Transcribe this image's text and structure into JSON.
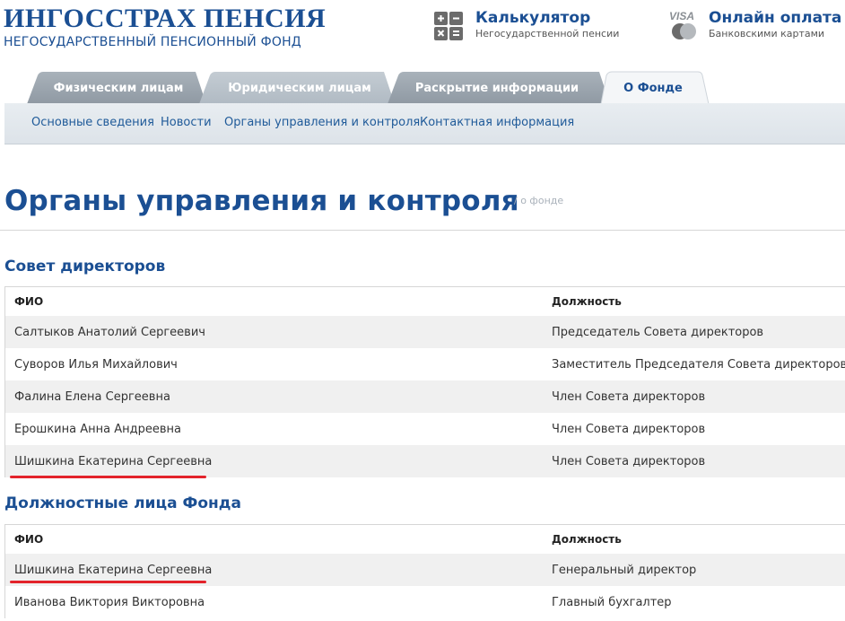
{
  "header": {
    "logo_title": "ИНГОССТРАХ ПЕНСИЯ",
    "logo_subtitle": "НЕГОСУДАРСТВЕННЫЙ ПЕНСИОННЫЙ ФОНД",
    "calculator": {
      "title": "Калькулятор",
      "subtitle": "Негосударственной пенсии",
      "icon": "calculator-icon"
    },
    "payment": {
      "title": "Онлайн оплата",
      "subtitle": "Банковскими картами",
      "icon": "visa-card-icon",
      "badge": "VISA"
    }
  },
  "tabs": [
    {
      "label": "Физическим лицам",
      "active": false
    },
    {
      "label": "Юридическим лицам",
      "active": false
    },
    {
      "label": "Раскрытие информации",
      "active": false
    },
    {
      "label": "О Фонде",
      "active": true
    }
  ],
  "subnav": [
    "Основные сведения",
    "Новости",
    "Органы управления и контроля",
    "Контактная информация"
  ],
  "page": {
    "title": "Органы управления и контроля",
    "breadcrumb": "/ о фонде"
  },
  "sections": [
    {
      "title": "Совет директоров",
      "headers": {
        "name": "ФИО",
        "position": "Должность"
      },
      "rows": [
        {
          "name": "Салтыков Анатолий Сергеевич",
          "position": "Председатель Совета директоров"
        },
        {
          "name": "Суворов Илья Михайлович",
          "position": "Заместитель Председателя Совета директоров"
        },
        {
          "name": "Фалина Елена Сергеевна",
          "position": "Член Совета директоров"
        },
        {
          "name": "Ерошкина Анна Андреевна",
          "position": "Член Совета директоров"
        },
        {
          "name": "Шишкина Екатерина Сергеевна",
          "position": "Член Совета директоров"
        }
      ]
    },
    {
      "title": "Должностные лица Фонда",
      "headers": {
        "name": "ФИО",
        "position": "Должность"
      },
      "rows": [
        {
          "name": "Шишкина Екатерина Сергеевна",
          "position": "Генеральный директор"
        },
        {
          "name": "Иванова Виктория Викторовна",
          "position": "Главный бухгалтер"
        }
      ]
    }
  ],
  "colors": {
    "brand_blue": "#1b4f93",
    "tab_gray": "#9aa4ad",
    "highlight_red": "#e3232b"
  }
}
